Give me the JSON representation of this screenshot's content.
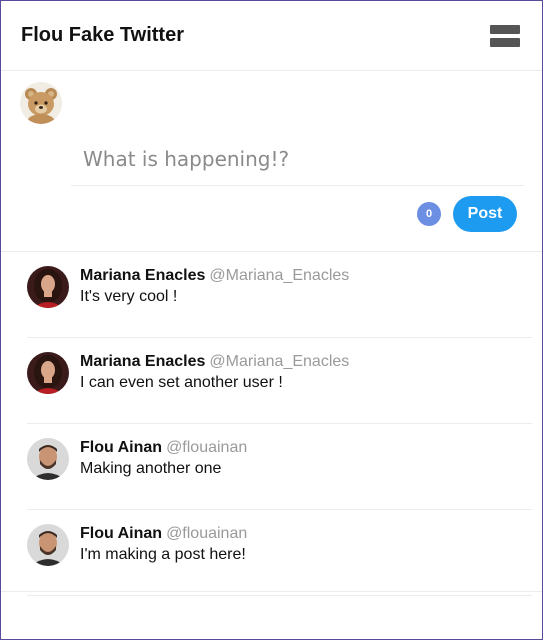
{
  "header": {
    "title": "Flou Fake Twitter",
    "menu_icon": "hamburger-menu-icon"
  },
  "compose": {
    "placeholder": "What is happening!?",
    "char_count": "0",
    "post_label": "Post",
    "avatar_icon": "teddy-bear-avatar"
  },
  "posts": [
    {
      "name": "Mariana Enacles",
      "handle": "@Mariana_Enacles",
      "text": "It's very cool !",
      "avatar": "woman-avatar"
    },
    {
      "name": "Mariana Enacles",
      "handle": "@Mariana_Enacles",
      "text": "I can even set another user !",
      "avatar": "woman-avatar"
    },
    {
      "name": "Flou Ainan",
      "handle": "@flouainan",
      "text": "Making another one",
      "avatar": "man-avatar"
    },
    {
      "name": "Flou Ainan",
      "handle": "@flouainan",
      "text": "I'm making a post here!",
      "avatar": "man-avatar"
    }
  ],
  "colors": {
    "accent": "#1d9bf0",
    "counter": "#6c8ee3",
    "handle": "#9a9a9a"
  }
}
